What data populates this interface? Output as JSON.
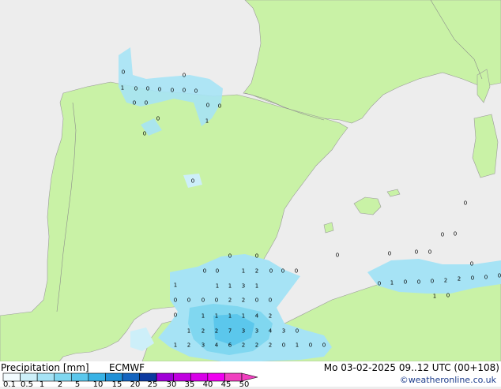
{
  "map": {
    "colors": {
      "sea": "#ededed",
      "land": "#c9f2a6",
      "border": "#9a9a9a"
    },
    "precipitation_values": [
      "0",
      "1",
      "0",
      "0",
      "0",
      "0",
      "0",
      "0",
      "0",
      "0",
      "0",
      "0",
      "0",
      "0",
      "1",
      "0",
      "0",
      "0",
      "0",
      "0",
      "0",
      "1",
      "2",
      "0",
      "0",
      "0",
      "1",
      "1",
      "3",
      "1",
      "1",
      "0",
      "0",
      "0",
      "0",
      "2",
      "2",
      "0",
      "0",
      "0",
      "1",
      "1",
      "1",
      "1",
      "4",
      "2",
      "1",
      "2",
      "2",
      "7",
      "3",
      "3",
      "4",
      "3",
      "0",
      "1",
      "2",
      "3",
      "4",
      "6",
      "2",
      "2",
      "2",
      "0",
      "1",
      "0",
      "0",
      "0",
      "0",
      "0",
      "0",
      "0",
      "0",
      "0",
      "0",
      "0",
      "1",
      "0",
      "0",
      "0",
      "2",
      "2",
      "0",
      "0",
      "0",
      "1",
      "0"
    ]
  },
  "footer": {
    "title": "Precipitation [mm]",
    "model": "ECMWF",
    "datetime": "Mo 03-02-2025 09..12 UTC (00+108)",
    "credit": "©weatheronline.co.uk",
    "legend_labels": [
      "0.1",
      "0.5",
      "1",
      "2",
      "5",
      "10",
      "15",
      "20",
      "25",
      "30",
      "35",
      "40",
      "45",
      "50"
    ],
    "legend_colors": [
      "#f2fbfe",
      "#cdeff9",
      "#a6e3f5",
      "#80d7f0",
      "#5bc7ec",
      "#38b2e5",
      "#1f90d6",
      "#1565c0",
      "#0c3aa0",
      "#a000d8",
      "#c000e0",
      "#d800e8",
      "#f000f0",
      "#f040c0"
    ]
  }
}
